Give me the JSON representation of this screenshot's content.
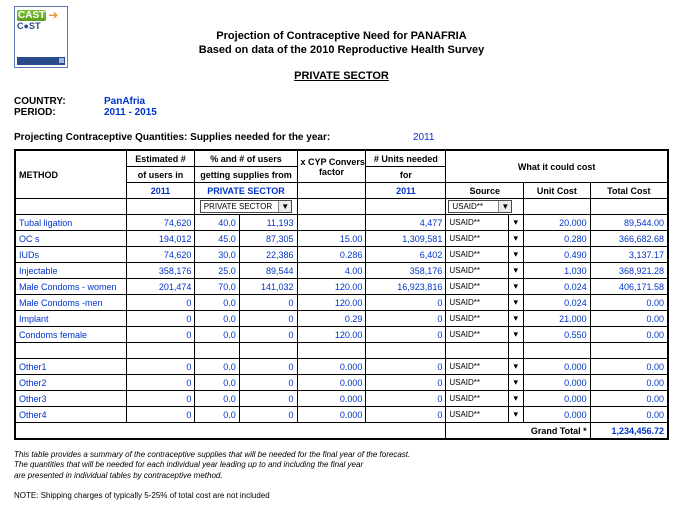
{
  "titles": {
    "main": "Projection of Contraceptive Need for PANAFRIA",
    "sub": "Based on data of the 2010 Reproductive Health Survey",
    "sector": "PRIVATE SECTOR"
  },
  "meta": {
    "country_label": "COUNTRY:",
    "country_value": "PanAfria",
    "period_label": "PERIOD:",
    "period_value": "2011 - 2015"
  },
  "projection_line": "Projecting Contraceptive Quantities: Supplies needed for the year:",
  "projection_year": "2011",
  "headers": {
    "method": "METHOD",
    "est1": "Estimated #",
    "est2": "of users in",
    "est3": "2011",
    "pct1": "% and # of users",
    "pct2": "getting supplies from",
    "pct3": "PRIVATE SECTOR",
    "cyp1": "x CYP Conversion",
    "cyp2": "factor",
    "units1": "# Units needed",
    "units2": "for",
    "units3": "2011",
    "cost_header": "What it could cost",
    "source": "Source",
    "unitcost": "Unit Cost",
    "totalcost": "Total Cost"
  },
  "dropdowns": {
    "sector": "PRIVATE SECTOR",
    "source": "USAID**"
  },
  "rows": [
    {
      "method": "Tubal ligation",
      "est": "74,620",
      "pct": "40.0",
      "num": "11,193",
      "cyp": "",
      "units": "4,477",
      "src": "USAID**",
      "unit": "20.000",
      "total": "89,544.00"
    },
    {
      "method": "OC s",
      "est": "194,012",
      "pct": "45.0",
      "num": "87,305",
      "cyp": "15.00",
      "units": "1,309,581",
      "src": "USAID**",
      "unit": "0.280",
      "total": "366,682.68"
    },
    {
      "method": "IUDs",
      "est": "74,620",
      "pct": "30.0",
      "num": "22,386",
      "cyp": "0.286",
      "units": "6,402",
      "src": "USAID**",
      "unit": "0.490",
      "total": "3,137.17"
    },
    {
      "method": "Injectable",
      "est": "358,176",
      "pct": "25.0",
      "num": "89,544",
      "cyp": "4.00",
      "units": "358,176",
      "src": "USAID**",
      "unit": "1.030",
      "total": "368,921.28"
    },
    {
      "method": "Male Condoms - women",
      "est": "201,474",
      "pct": "70.0",
      "num": "141,032",
      "cyp": "120.00",
      "units": "16,923,816",
      "src": "USAID**",
      "unit": "0.024",
      "total": "406,171.58"
    },
    {
      "method": "Male Condoms -men",
      "est": "0",
      "pct": "0.0",
      "num": "0",
      "cyp": "120.00",
      "units": "0",
      "src": "USAID**",
      "unit": "0.024",
      "total": "0.00"
    },
    {
      "method": "Implant",
      "est": "0",
      "pct": "0.0",
      "num": "0",
      "cyp": "0.29",
      "units": "0",
      "src": "USAID**",
      "unit": "21.000",
      "total": "0.00"
    },
    {
      "method": "Condoms female",
      "est": "0",
      "pct": "0.0",
      "num": "0",
      "cyp": "120.00",
      "units": "0",
      "src": "USAID**",
      "unit": "0.550",
      "total": "0.00"
    }
  ],
  "other_rows": [
    {
      "method": "Other1",
      "est": "0",
      "pct": "0.0",
      "num": "0",
      "cyp": "0.000",
      "units": "0",
      "src": "USAID**",
      "unit": "0.000",
      "total": "0.00"
    },
    {
      "method": "Other2",
      "est": "0",
      "pct": "0.0",
      "num": "0",
      "cyp": "0.000",
      "units": "0",
      "src": "USAID**",
      "unit": "0.000",
      "total": "0.00"
    },
    {
      "method": "Other3",
      "est": "0",
      "pct": "0.0",
      "num": "0",
      "cyp": "0.000",
      "units": "0",
      "src": "USAID**",
      "unit": "0.000",
      "total": "0.00"
    },
    {
      "method": "Other4",
      "est": "0",
      "pct": "0.0",
      "num": "0",
      "cyp": "0.000",
      "units": "0",
      "src": "USAID**",
      "unit": "0.000",
      "total": "0.00"
    }
  ],
  "grand_total": {
    "label": "Grand Total *",
    "value": "1,234,456.72"
  },
  "footnotes": {
    "l1": "This table provides a summary of the contraceptive supplies that will be needed for the final year of the forecast.",
    "l2": "The quantities that will be needed for each individual year leading up to and including the final year",
    "l3": "are presented in individual tables by contraceptive method.",
    "note": "NOTE: Shipping charges of typically 5-25% of total cost are not included"
  }
}
